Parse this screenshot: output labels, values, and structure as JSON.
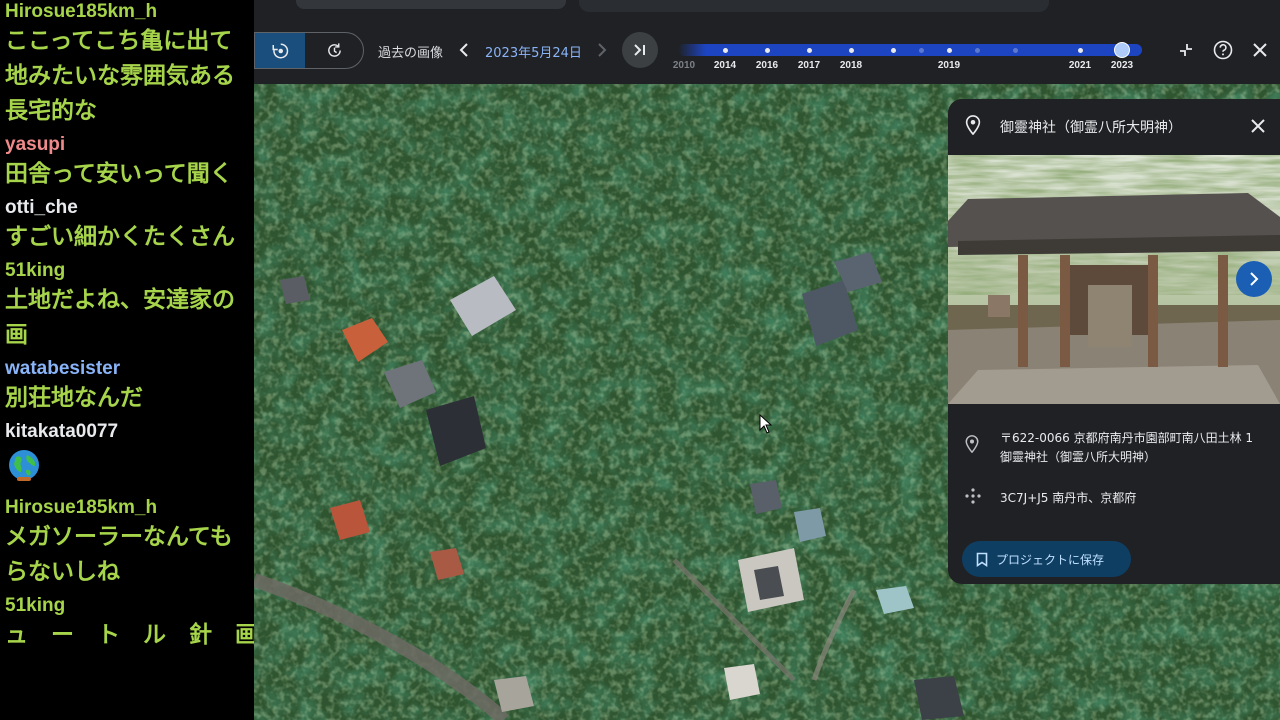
{
  "chat": {
    "messages": [
      {
        "user": "Hirosue185km_h",
        "user_color": "#a6d44a",
        "lines": [
          "ここってこち亀に出て",
          "地みたいな雰囲気ある",
          "長宅的な"
        ]
      },
      {
        "user": "yasupi",
        "user_color": "#f08a8a",
        "lines": [
          "田舎って安いって聞く"
        ]
      },
      {
        "user": "otti_che",
        "user_color": "#e8eaed",
        "lines": [
          "すごい細かくたくさん"
        ]
      },
      {
        "user": "51king",
        "user_color": "#a6d44a",
        "lines": [
          "土地だよね、安達家の",
          "画"
        ]
      },
      {
        "user": "watabesister",
        "user_color": "#8ab4f8",
        "lines": [
          "別荘地なんだ"
        ]
      },
      {
        "user": "kitakata0077",
        "user_color": "#e8eaed",
        "lines": [],
        "emoji": "globe-emoji"
      },
      {
        "user": "Hirosue185km_h",
        "user_color": "#a6d44a",
        "lines": [
          "メガソーラーなんても",
          "らないしね"
        ]
      },
      {
        "user": "51king",
        "user_color": "#a6d44a",
        "lines": [
          "ュ　ー　ト　ル　針　画　の　緑　け"
        ]
      }
    ]
  },
  "toolbar": {
    "historical_label": "過去の画像",
    "current_date": "2023年5月24日",
    "icons": {
      "history_mode": "history-icon",
      "clock_mode": "clock-icon",
      "prev": "chevron-left-icon",
      "next": "chevron-right-icon",
      "latest": "skip-to-latest-icon",
      "shrink": "collapse-icon",
      "help": "help-icon",
      "close": "close-icon"
    }
  },
  "timeline": {
    "year_labels": [
      "2010",
      "2014",
      "2016",
      "2017",
      "2018",
      "2019",
      "2021",
      "2023"
    ],
    "selected_year": "2023",
    "accent_color": "#1d45c2"
  },
  "place_panel": {
    "title": "御靈神社（御霊八所大明神）",
    "address": "〒622-0066 京都府南丹市園部町南八田土林 1 御靈神社（御霊八所大明神）",
    "plus_code": "3C7J+J5 南丹市、京都府",
    "save_label": "プロジェクトに保存"
  }
}
